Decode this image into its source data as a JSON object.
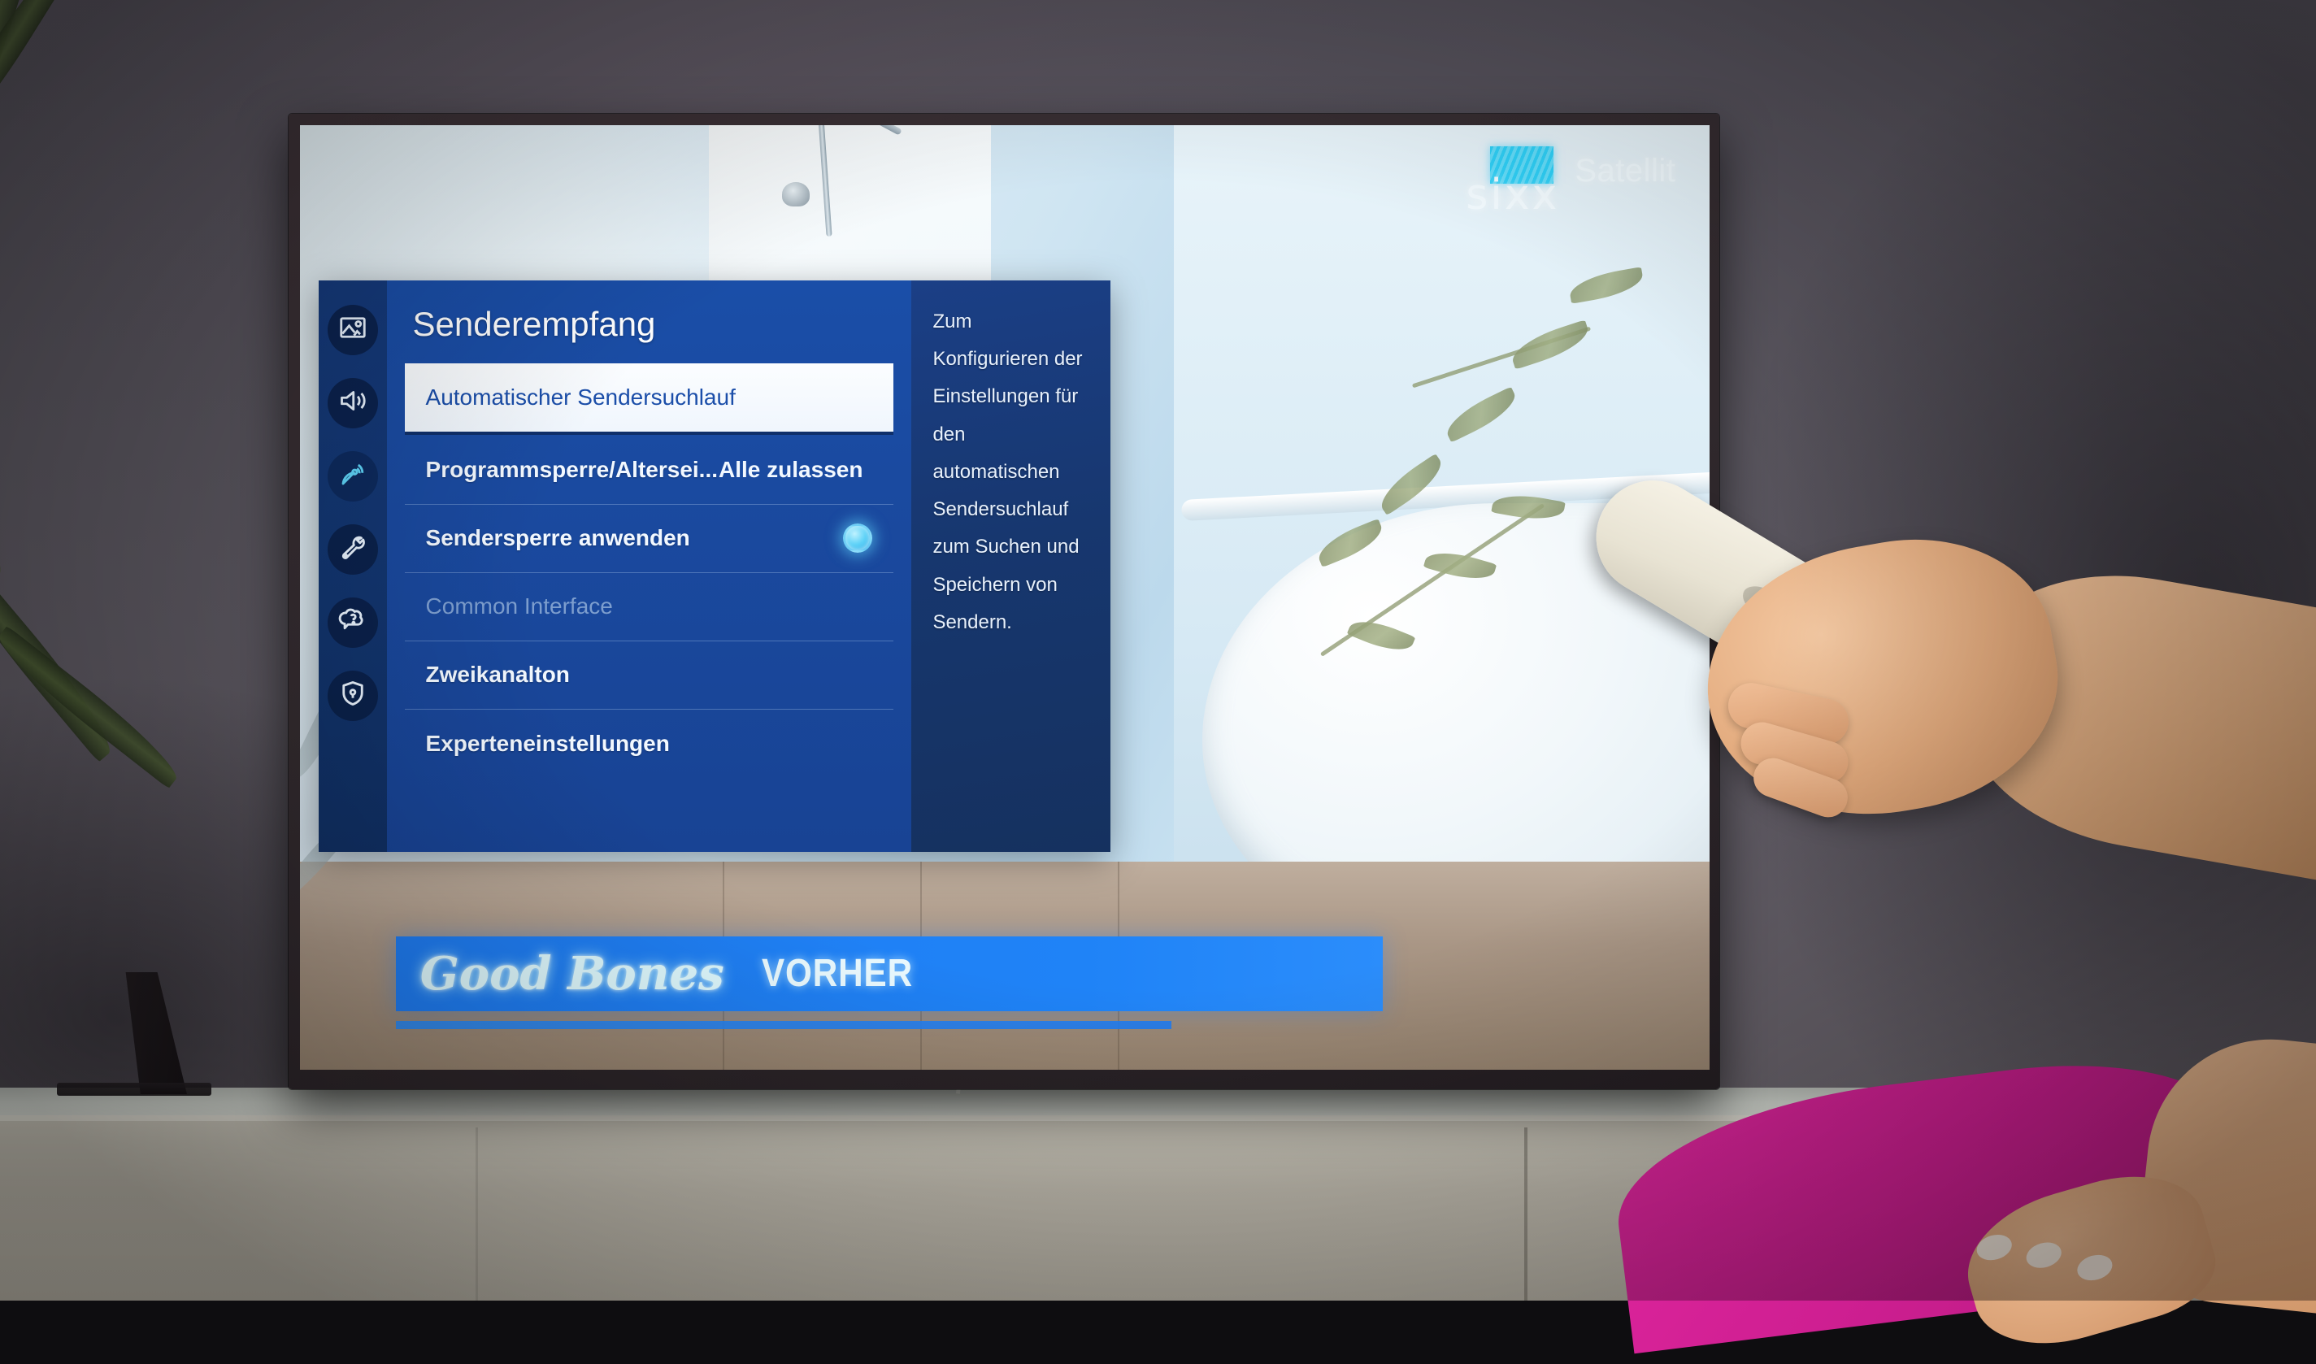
{
  "tv": {
    "channel": {
      "logo_name": "sixx",
      "source_label": "Satellit"
    },
    "show_banner": {
      "title": "Good Bones",
      "tag": "VORHER"
    }
  },
  "menu": {
    "title": "Senderempfang",
    "rail": [
      {
        "icon": "picture-icon",
        "name": "sidebar-item-picture",
        "active": false
      },
      {
        "icon": "sound-icon",
        "name": "sidebar-item-sound",
        "active": false
      },
      {
        "icon": "broadcast-dish-icon",
        "name": "sidebar-item-broadcast",
        "active": true
      },
      {
        "icon": "wrench-icon",
        "name": "sidebar-item-general",
        "active": false
      },
      {
        "icon": "support-bubble-icon",
        "name": "sidebar-item-support",
        "active": false
      },
      {
        "icon": "shield-lock-icon",
        "name": "sidebar-item-privacy",
        "active": false
      }
    ],
    "rows": [
      {
        "label": "Automatischer Sendersuchlauf",
        "value": "",
        "selected": true,
        "disabled": false,
        "control": "none"
      },
      {
        "label": "Programmsperre/Altersei...",
        "value": "Alle zulassen",
        "selected": false,
        "disabled": false,
        "control": "value"
      },
      {
        "label": "Sendersperre anwenden",
        "value": "",
        "selected": false,
        "disabled": false,
        "control": "toggle"
      },
      {
        "label": "Common Interface",
        "value": "",
        "selected": false,
        "disabled": true,
        "control": "none"
      },
      {
        "label": "Zweikanalton",
        "value": "",
        "selected": false,
        "disabled": false,
        "control": "none"
      },
      {
        "label": "Experteneinstellungen",
        "value": "",
        "selected": false,
        "disabled": false,
        "control": "none"
      }
    ],
    "help": "Zum Konfigurieren der Einstellungen für den automatischen Sendersuchlauf zum Suchen und Speichern von Sendern."
  },
  "colors": {
    "menu_blue": "#1a4aa0",
    "rail_blue": "#12356f",
    "help_blue": "#17376f",
    "accent_cyan": "#5fd2f7",
    "banner_blue": "#1f7cf2",
    "selected_bg": "#f5fafe",
    "selected_text": "#1b4ea9",
    "disabled_text": "#7d9ece"
  }
}
